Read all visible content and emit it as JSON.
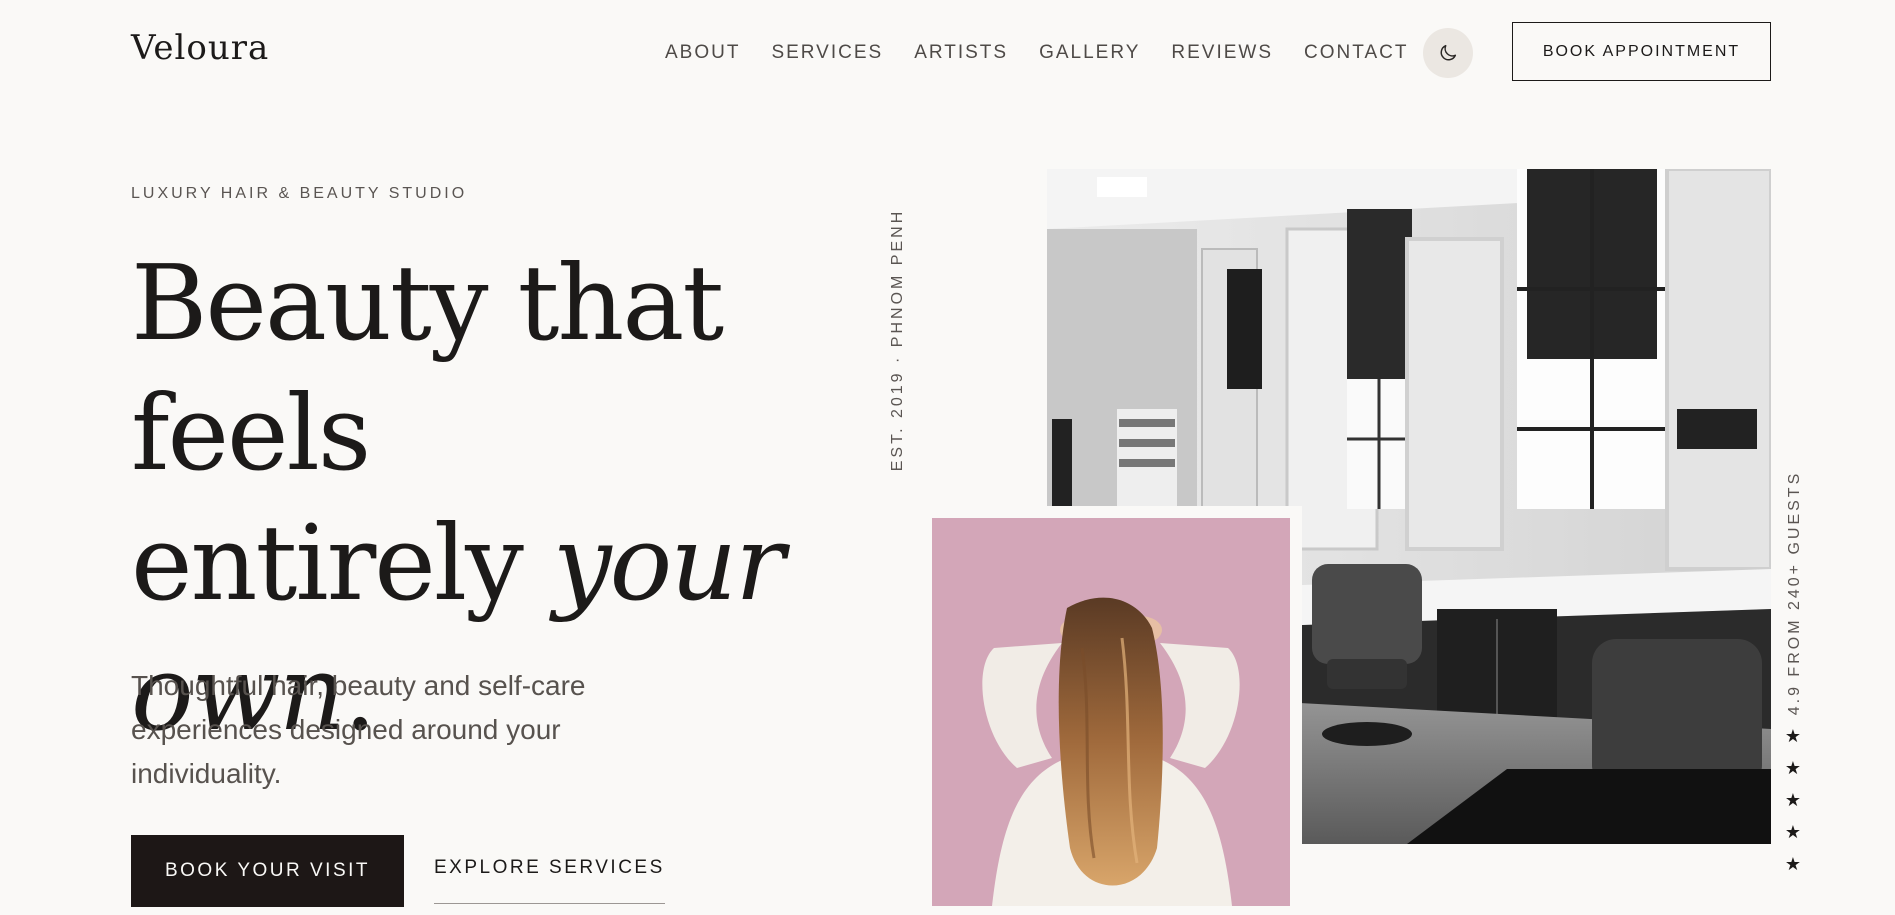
{
  "brand": {
    "name": "Veloura"
  },
  "nav": {
    "items": [
      {
        "label": "ABOUT"
      },
      {
        "label": "SERVICES"
      },
      {
        "label": "ARTISTS"
      },
      {
        "label": "GALLERY"
      },
      {
        "label": "REVIEWS"
      },
      {
        "label": "CONTACT"
      }
    ],
    "theme_toggle_icon": "moon-icon",
    "book_label": "BOOK APPOINTMENT"
  },
  "hero": {
    "eyebrow": "LUXURY HAIR & BEAUTY STUDIO",
    "headline_line1": "Beauty that feels",
    "headline_line2_plain": "entirely ",
    "headline_line2_italic": "your",
    "headline_line3_italic": "own",
    "headline_line3_plain": ".",
    "subtitle": "Thoughtful hair, beauty and self-care experiences designed around your individuality.",
    "primary_cta": "BOOK YOUR VISIT",
    "secondary_cta": "EXPLORE SERVICES",
    "established": "EST. 2019 · PHNOM PENH"
  },
  "rating": {
    "text": "4.9 FROM 240+ GUESTS",
    "stars": 5,
    "star_glyph": "★"
  },
  "colors": {
    "background": "#faf9f7",
    "ink": "#1c1a19",
    "primary_button": "#1d1716",
    "portrait_backdrop": "#d3a6b8"
  }
}
